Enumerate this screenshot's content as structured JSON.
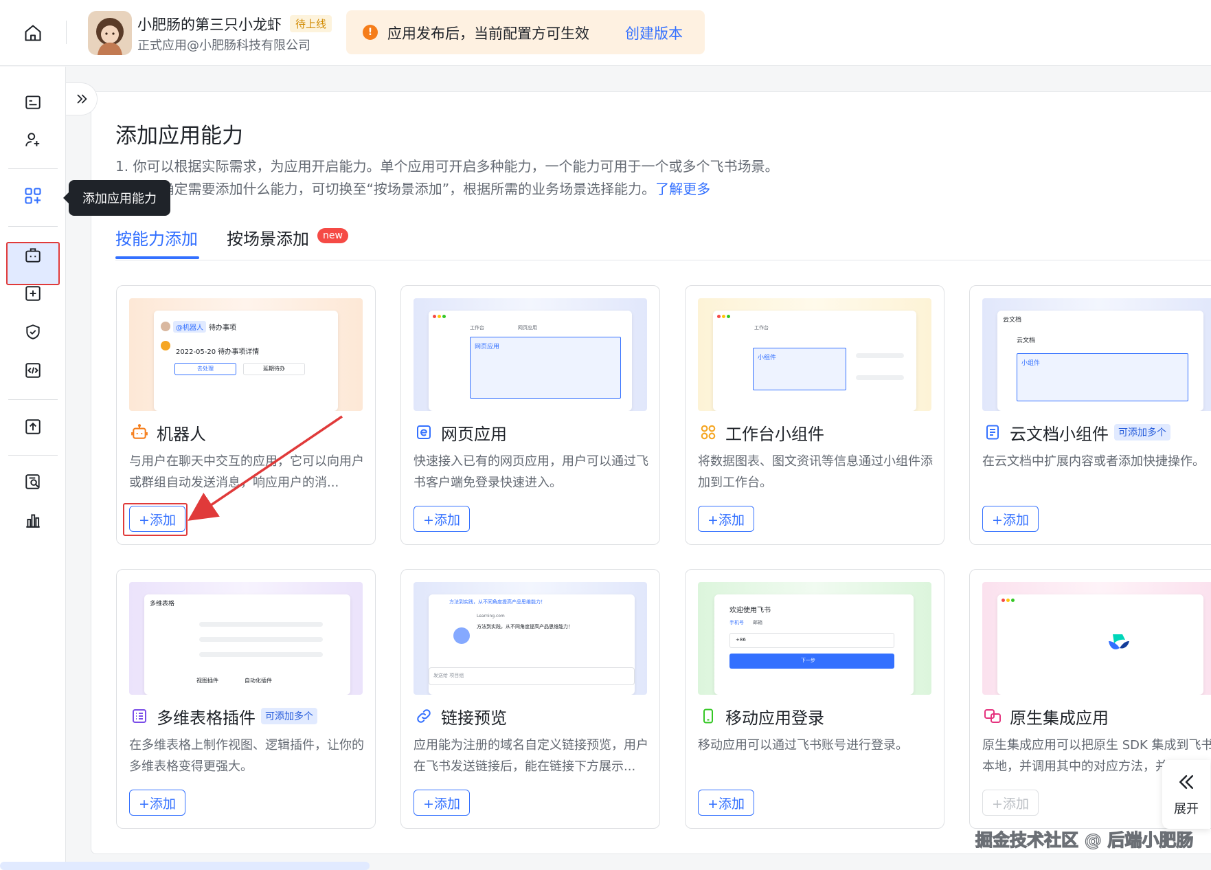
{
  "topbar": {
    "app_name": "小肥肠的第三只小龙虾",
    "status": "待上线",
    "org": "正式应用@小肥肠科技有限公司",
    "notice_text": "应用发布后，当前配置方可生效",
    "notice_link": "创建版本",
    "notice_icon": "warning-icon",
    "home_icon": "home-icon"
  },
  "sidebar": {
    "icons": [
      "credentials-icon",
      "member-icon",
      "add-capability-icon",
      "robot-box-icon",
      "add-square-icon",
      "shield-check-icon",
      "code-icon",
      "upload-icon",
      "search-doc-icon",
      "chart-icon"
    ],
    "tooltip": "添加应用能力"
  },
  "main": {
    "title": "添加应用能力",
    "desc1": "1. 你可以根据实际需求，为应用开启能力。单个应用可开启多种能力，一个能力可用于一个或多个飞书场景。",
    "desc2": "2. 若不确定需要添加什么能力，可切换至“按场景添加”，根据所需的业务场景选择能力。",
    "learn_more": "了解更多",
    "tabs": [
      {
        "label": "按能力添加"
      },
      {
        "label": "按场景添加"
      }
    ],
    "new_badge": "new"
  },
  "cards": [
    {
      "name": "机器人",
      "desc": "与用户在聊天中交互的应用，它可以向用户或群组自动发送消息，响应用户的消...",
      "add": "+添加",
      "badge": ""
    },
    {
      "name": "网页应用",
      "desc": "快速接入已有的网页应用，用户可以通过飞书客户端免登录快速进入。",
      "add": "+添加",
      "badge": ""
    },
    {
      "name": "工作台小组件",
      "desc": "将数据图表、图文资讯等信息通过小组件添加到工作台。",
      "add": "+添加",
      "badge": ""
    },
    {
      "name": "云文档小组件",
      "desc": "在云文档中扩展内容或者添加快捷操作。",
      "add": "+添加",
      "badge": "可添加多个"
    },
    {
      "name": "多维表格插件",
      "desc": "在多维表格上制作视图、逻辑插件，让你的多维表格变得更强大。",
      "add": "+添加",
      "badge": "可添加多个"
    },
    {
      "name": "链接预览",
      "desc": "应用能为注册的域名自定义链接预览，用户在飞书发送链接后，能在链接下方展示...",
      "add": "+添加",
      "badge": ""
    },
    {
      "name": "移动应用登录",
      "desc": "移动应用可以通过飞书账号进行登录。",
      "add": "+添加",
      "badge": ""
    },
    {
      "name": "原生集成应用",
      "desc": "原生集成应用可以把原生 SDK 集成到飞书本地，并调用其中的对应方法，并",
      "add": "+添加",
      "badge": ""
    }
  ],
  "previews": {
    "robot": {
      "tag": "@机器人",
      "tag2": "待办事项",
      "date": "2022-05-20 待办事项详情",
      "btn1": "去处理",
      "btn2": "延期待办"
    },
    "web": {
      "tab1": "工作台",
      "tab2": "网页应用",
      "label": "网页应用"
    },
    "widget": {
      "tab1": "工作台",
      "label": "小组件"
    },
    "doc": {
      "head": "云文档",
      "sub": "云文档",
      "label": "小组件"
    },
    "bitable": {
      "head": "多维表格",
      "p1": "视图插件",
      "p2": "自动化插件"
    },
    "link": {
      "msg": "方法到实践，从不同角度提高产品思维能力！",
      "site": "Learning.com",
      "body": "方法到实践，从不同角度提高产品思维能力！",
      "input": "发送给 项目组"
    },
    "mobile": {
      "welcome": "欢迎使用飞书",
      "t1": "手机号",
      "t2": "邮箱",
      "code": "+86",
      "btn": "下一步"
    }
  },
  "expand": {
    "label": "展开",
    "icon": "double-chevron-left-icon"
  },
  "watermark": "掘金技术社区 @ 后端小肥肠",
  "colors": {
    "accent": "#3370ff",
    "highlight": "#e03a3a",
    "warning": "#f57d1a"
  }
}
